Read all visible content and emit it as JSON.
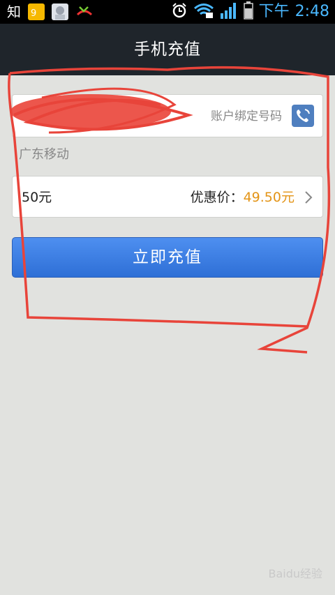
{
  "status_bar": {
    "left_text": "知",
    "ampm": "下午",
    "time": "2:48",
    "icons": [
      "app-icon-yellow",
      "app-icon-anime",
      "missed-call-icon",
      "alarm-icon",
      "wifi-icon",
      "signal-icon",
      "battery-icon"
    ]
  },
  "header": {
    "title": "手机充值"
  },
  "phone_field": {
    "value": "",
    "bound_label": "账户绑定号码",
    "contact_icon": "contact-phone-icon"
  },
  "carrier": "广东移动",
  "amount": {
    "value": "50元",
    "discount_label": "优惠价：",
    "discount_price": "49.50元"
  },
  "recharge_button": "立即充值",
  "colors": {
    "title_bar": "#1f252b",
    "button": "#3a7ce2",
    "price": "#e39417",
    "annotation": "#e8443a"
  },
  "watermark": "Baidu经验"
}
